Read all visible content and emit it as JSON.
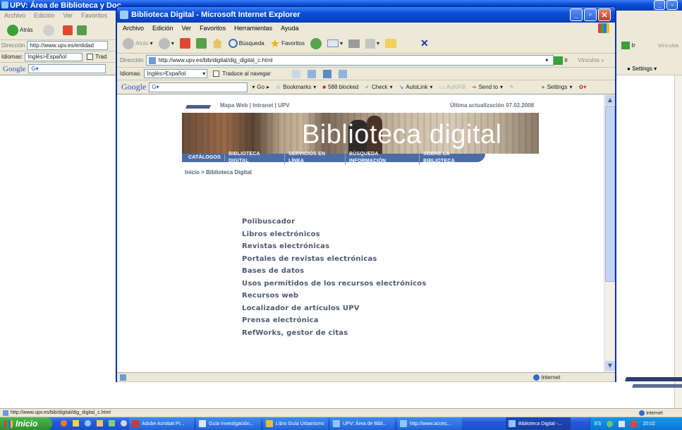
{
  "bg_window": {
    "title": "UPV: Área de Biblioteca y Doc",
    "menu": [
      "Archivo",
      "Edición",
      "Ver",
      "Favoritos"
    ],
    "back_label": "Atrás",
    "address_label": "Dirección",
    "address_value": "http://www.upv.es/entidad",
    "go_label": "Ir",
    "links_label": "Vínculos",
    "idiomas_label": "Idiomas:",
    "idiomas_value": "Inglés>Español",
    "traduce_partial": "Trad",
    "google_label": "Google",
    "settings_label": "Settings",
    "status_url": "http://www.upv.es/bib/digital/dig_digital_c.html",
    "status_zone": "Internet"
  },
  "ie_window": {
    "title": "Biblioteca Digital - Microsoft Internet Explorer",
    "menu": [
      "Archivo",
      "Edición",
      "Ver",
      "Favoritos",
      "Herramientas",
      "Ayuda"
    ],
    "toolbar": {
      "back": "Atrás",
      "search": "Búsqueda",
      "favorites": "Favoritos"
    },
    "address_label": "Dirección",
    "address_value": "http://www.upv.es/bib/digital/dig_digital_c.html",
    "go_label": "Ir",
    "links_label": "Vínculos",
    "idiomas_label": "Idiomas:",
    "idiomas_value": "Inglés>Español",
    "traduce_label": "Traduce al navegar",
    "google": {
      "logo": "Google",
      "go": "Go",
      "bookmarks": "Bookmarks",
      "blocked": "588 blocked",
      "check": "Check",
      "autolink": "AutoLink",
      "autofill": "AutoFill",
      "sendto": "Send to",
      "settings": "Settings"
    },
    "status_zone": "Internet"
  },
  "page": {
    "header_links": "Mapa Web | Intranet | UPV",
    "updated": "Última actualización 07.02.2008",
    "banner_text": "Biblioteca digital",
    "nav": [
      "CATÁLOGOS",
      "BIBLIOTECA DIGITAL",
      "SERVICIOS EN LÍNEA",
      "BÚSQUEDA INFORMACIÓN",
      "SOBRE LA BIBLIOTECA"
    ],
    "breadcrumb": "Inicio > Biblioteca Digital",
    "links": [
      "Polibuscador",
      "Libros electrónicos",
      "Revistas electrónicas",
      "Portales de revistas electrónicas",
      "Bases de datos",
      "Usos permitidos de los recursos electrónicos",
      "Recursos web",
      "Localizador de artículos UPV",
      "Prensa electrónica",
      "RefWorks, gestor de citas"
    ]
  },
  "taskbar": {
    "start": "Inicio",
    "tasks": [
      "Adobe Acrobat Pr...",
      "Guía Investigación...",
      "Libro Guía Urbanismo",
      "UPV: Área de Bibl...",
      "http://www.acces...",
      "Biblioteca Digital -..."
    ],
    "lang": "ES",
    "clock": "20:02"
  },
  "colors": {
    "xp_blue": "#0a4fd9",
    "nav_bar": "#4a6da8",
    "link": "#4d5a73",
    "window_bg": "#ece9d8"
  }
}
